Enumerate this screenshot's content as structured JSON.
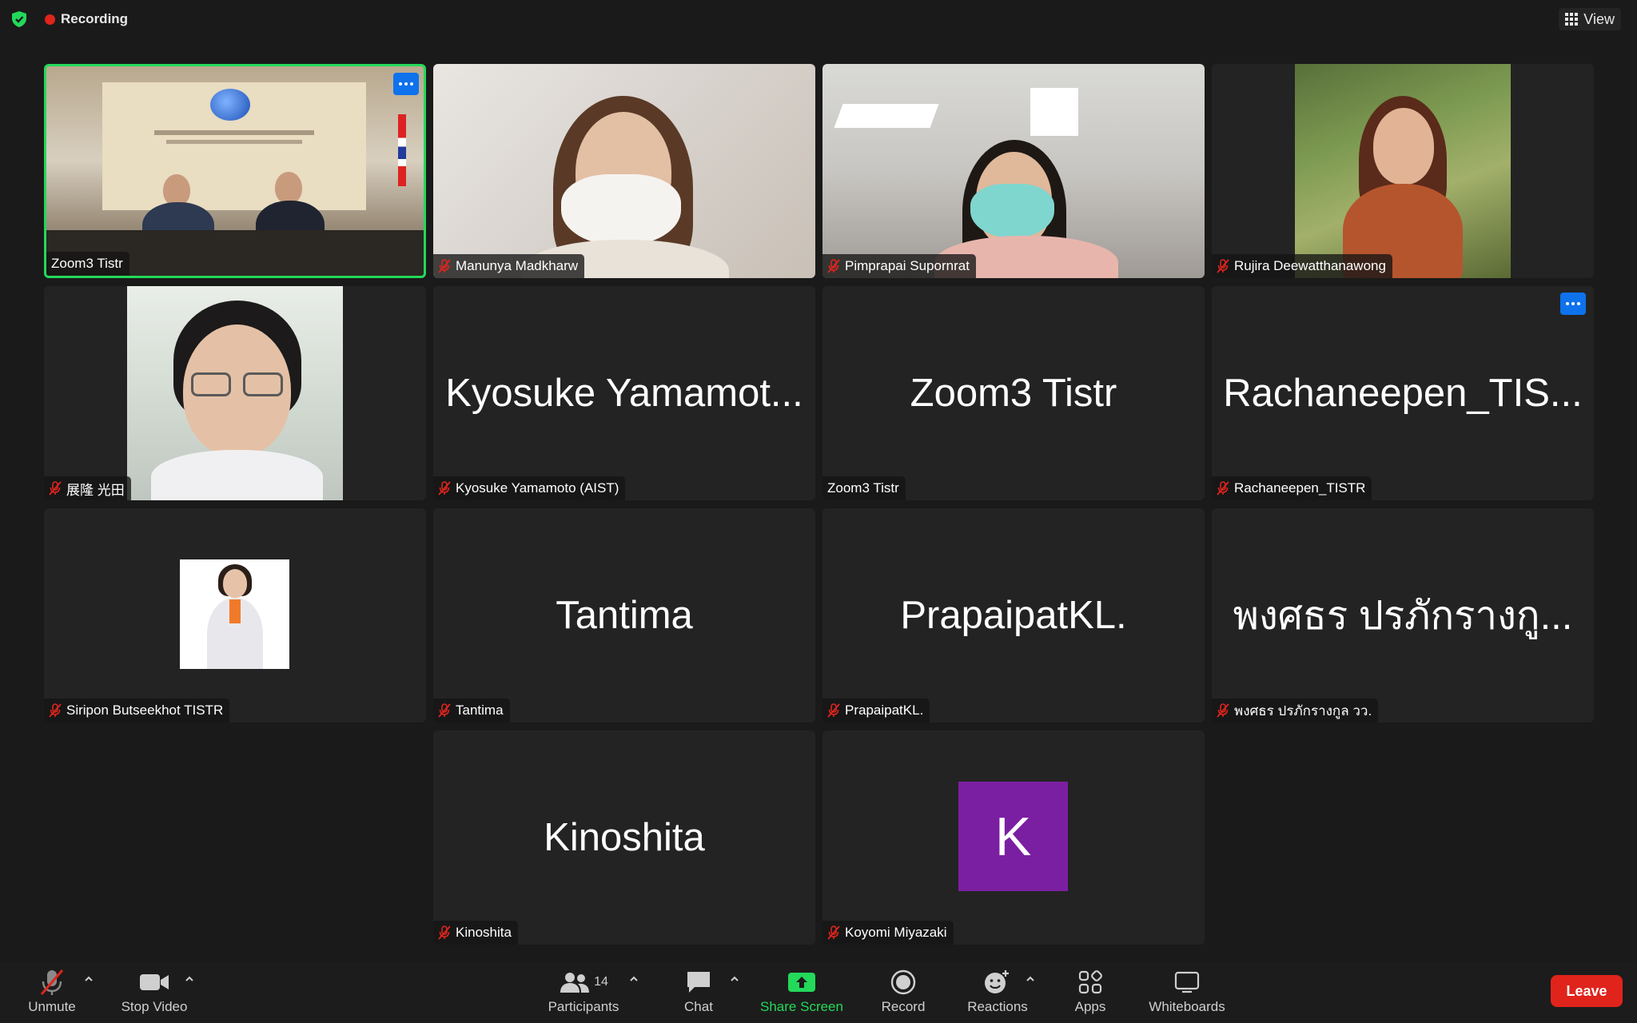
{
  "topbar": {
    "recording_label": "Recording",
    "view_label": "View"
  },
  "tiles": [
    {
      "big": "",
      "tag": "Zoom3 Tistr"
    },
    {
      "big": "",
      "tag": "Manunya Madkharw"
    },
    {
      "big": "",
      "tag": "Pimprapai Supornrat"
    },
    {
      "big": "",
      "tag": "Rujira Deewatthanawong"
    },
    {
      "big": "",
      "tag": "展隆 光田"
    },
    {
      "big": "Kyosuke Yamamot...",
      "tag": "Kyosuke Yamamoto (AIST)"
    },
    {
      "big": "Zoom3 Tistr",
      "tag": "Zoom3 Tistr"
    },
    {
      "big": "Rachaneepen_TIS...",
      "tag": "Rachaneepen_TISTR"
    },
    {
      "big": "",
      "tag": "Siripon Butseekhot TISTR"
    },
    {
      "big": "Tantima",
      "tag": "Tantima"
    },
    {
      "big": "PrapaipatKL.",
      "tag": "PrapaipatKL."
    },
    {
      "big": "พงศธร ปรภักรางกู...",
      "tag": "พงศธร ปรภักรางกูล วว."
    },
    {
      "big": "Kinoshita",
      "tag": "Kinoshita"
    },
    {
      "big": "",
      "tag": "Koyomi Miyazaki",
      "avatar_letter": "K"
    }
  ],
  "toolbar": {
    "unmute": "Unmute",
    "stop_video": "Stop Video",
    "participants": "Participants",
    "participants_count": "14",
    "chat": "Chat",
    "share_screen": "Share Screen",
    "record": "Record",
    "reactions": "Reactions",
    "apps": "Apps",
    "whiteboards": "Whiteboards",
    "leave": "Leave"
  },
  "colors": {
    "active_speaker_border": "#23d959",
    "more_button": "#0e72ed",
    "leave": "#e0241c",
    "share_screen": "#23d959",
    "avatar_k": "#7b1fa2"
  }
}
